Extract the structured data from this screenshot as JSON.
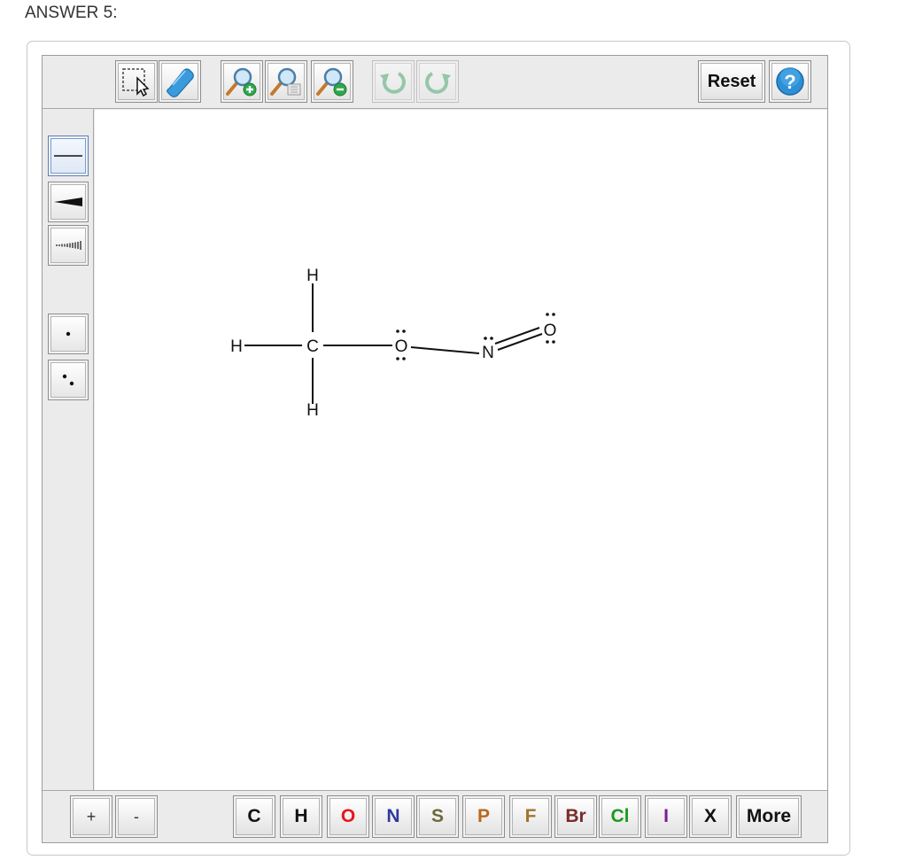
{
  "title": "ANSWER 5:",
  "top_toolbar": {
    "tools": [
      {
        "name": "select-tool",
        "icon": "lasso-select-icon"
      },
      {
        "name": "eraser-tool",
        "icon": "eraser-icon"
      },
      {
        "name": "zoom-in-tool",
        "icon": "zoom-in-icon"
      },
      {
        "name": "zoom-fit-tool",
        "icon": "zoom-fit-icon"
      },
      {
        "name": "zoom-out-tool",
        "icon": "zoom-out-icon"
      },
      {
        "name": "undo-tool",
        "icon": "undo-icon",
        "disabled": true
      },
      {
        "name": "redo-tool",
        "icon": "redo-icon",
        "disabled": true
      }
    ],
    "reset_label": "Reset",
    "help_label": "?",
    "help_icon": "help-icon"
  },
  "left_toolbar": {
    "tools": [
      {
        "name": "single-bond-tool",
        "icon": "single-bond-icon",
        "selected": true
      },
      {
        "name": "wedge-bond-tool",
        "icon": "wedge-bond-icon"
      },
      {
        "name": "hash-bond-tool",
        "icon": "hash-bond-icon"
      },
      {
        "name": "radical-tool",
        "icon": "single-dot-icon"
      },
      {
        "name": "lone-pair-tool",
        "icon": "lone-pair-icon"
      }
    ]
  },
  "molecule": {
    "atoms": {
      "h_top": "H",
      "h_left": "H",
      "c": "C",
      "h_bottom": "H",
      "o1": "O",
      "n": "N",
      "o2": "O"
    }
  },
  "bottom_toolbar": {
    "charge_plus": "+",
    "charge_minus": "-",
    "elements": [
      {
        "symbol": "C",
        "color": "#111111"
      },
      {
        "symbol": "H",
        "color": "#111111"
      },
      {
        "symbol": "O",
        "color": "#e8141b"
      },
      {
        "symbol": "N",
        "color": "#2f3a9a"
      },
      {
        "symbol": "S",
        "color": "#6b6b3a"
      },
      {
        "symbol": "P",
        "color": "#b86a1c"
      },
      {
        "symbol": "F",
        "color": "#a0742e"
      },
      {
        "symbol": "Br",
        "color": "#7a2a2a"
      },
      {
        "symbol": "Cl",
        "color": "#1f9a1f"
      },
      {
        "symbol": "I",
        "color": "#7a1c9a"
      },
      {
        "symbol": "X",
        "color": "#111111"
      }
    ],
    "more_label": "More"
  }
}
